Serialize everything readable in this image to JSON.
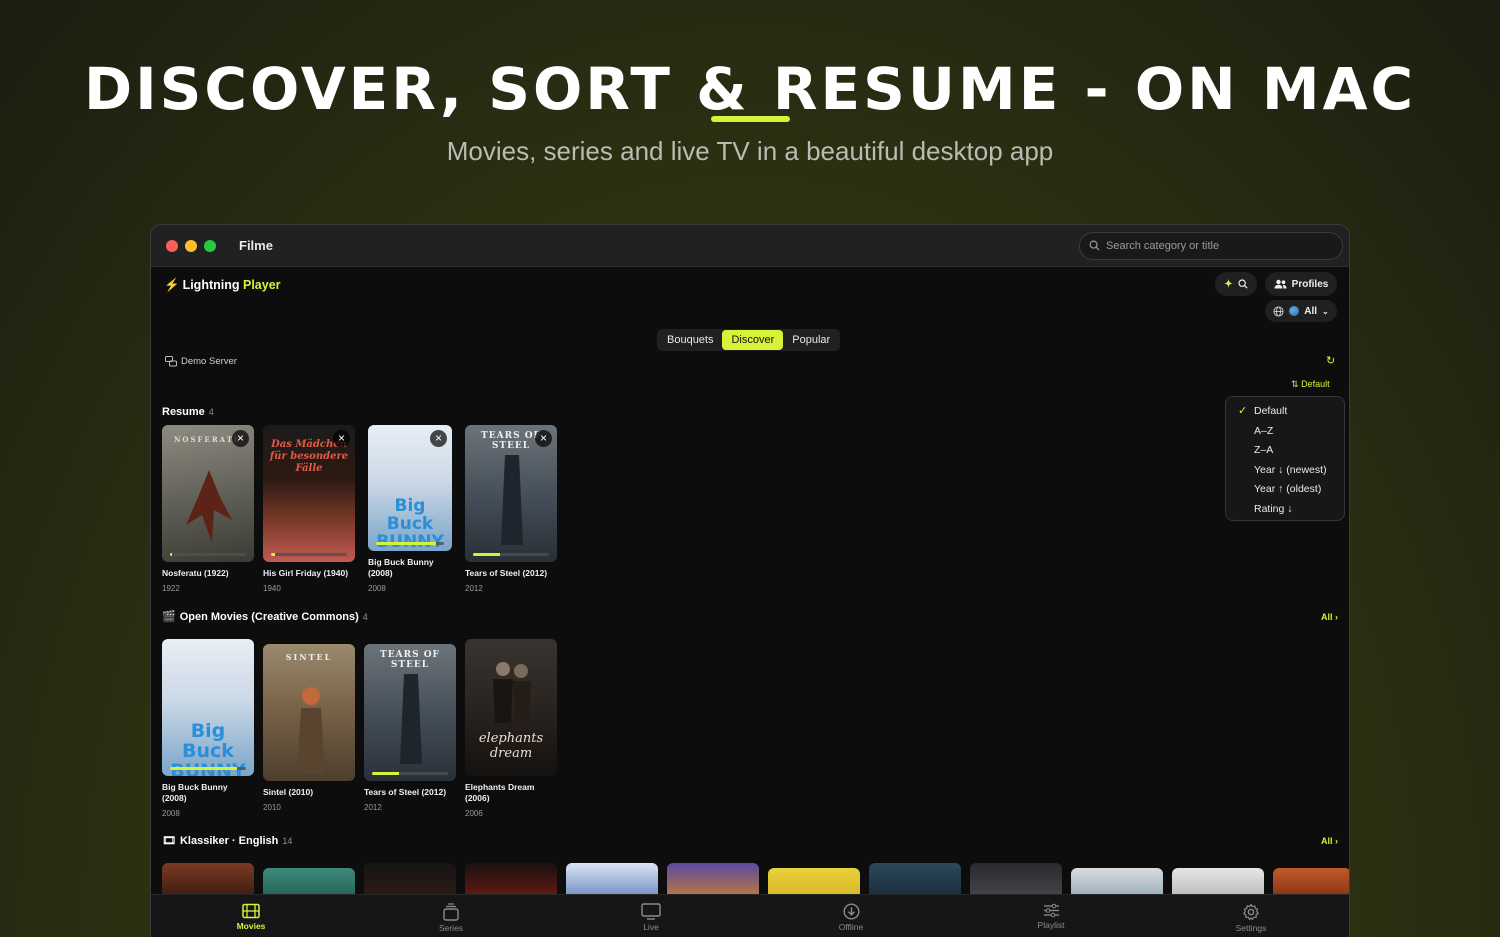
{
  "hero": {
    "title": "DISCOVER, SORT & RESUME - ON MAC",
    "subtitle": "Movies, series and live TV in a beautiful desktop app",
    "accent_color": "#d8f23a"
  },
  "window": {
    "title": "Filme",
    "search_placeholder": "Search category or title"
  },
  "brand": {
    "name_part1": "Lightning",
    "name_part2": "Player"
  },
  "header": {
    "profiles_label": "Profiles",
    "language_label": "All"
  },
  "tabs": [
    {
      "label": "Bouquets",
      "active": false
    },
    {
      "label": "Discover",
      "active": true
    },
    {
      "label": "Popular",
      "active": false
    }
  ],
  "server": {
    "label": "Demo Server"
  },
  "sort": {
    "current_label": "Default",
    "options": [
      "Default",
      "A–Z",
      "Z–A",
      "Year ↓ (newest)",
      "Year ↑ (oldest)",
      "Rating ↓"
    ],
    "selected_index": 0
  },
  "sections": {
    "resume": {
      "title": "Resume",
      "count": "4",
      "items": [
        {
          "title": "Nosferatu (1922)",
          "year": "1922",
          "poster_text": "NOSFERATU",
          "progress": 0.02
        },
        {
          "title": "His Girl Friday (1940)",
          "year": "1940",
          "poster_text": "Das Mädchen für besondere Fälle",
          "progress": 0.05
        },
        {
          "title": "Big Buck Bunny (2008)",
          "year": "2008",
          "poster_text": "Big Buck BUNNY",
          "progress": 0.88
        },
        {
          "title": "Tears of Steel (2012)",
          "year": "2012",
          "poster_text": "TEARS OF STEEL",
          "progress": 0.35
        }
      ]
    },
    "open_movies": {
      "title": "Open Movies (Creative Commons)",
      "count": "4",
      "all_label": "All ›",
      "items": [
        {
          "title": "Big Buck Bunny (2008)",
          "year": "2008",
          "poster_text": "Big Buck BUNNY",
          "progress": 0.88
        },
        {
          "title": "Sintel (2010)",
          "year": "2010",
          "poster_text": "SINTEL",
          "progress": null
        },
        {
          "title": "Tears of Steel (2012)",
          "year": "2012",
          "poster_text": "TEARS OF STEEL",
          "progress": 0.35
        },
        {
          "title": "Elephants Dream (2006)",
          "year": "2006",
          "poster_text": "elephants dream",
          "progress": null
        }
      ]
    },
    "classics": {
      "title": "Klassiker · English",
      "count": "14",
      "all_label": "All ›"
    }
  },
  "nav": [
    {
      "label": "Movies",
      "icon": "film-icon",
      "active": true
    },
    {
      "label": "Series",
      "icon": "stack-icon",
      "active": false
    },
    {
      "label": "Live",
      "icon": "tv-icon",
      "active": false
    },
    {
      "label": "Offline",
      "icon": "download-icon",
      "active": false
    },
    {
      "label": "Playlist",
      "icon": "sliders-icon",
      "active": false
    },
    {
      "label": "Settings",
      "icon": "gear-icon",
      "active": false
    }
  ]
}
